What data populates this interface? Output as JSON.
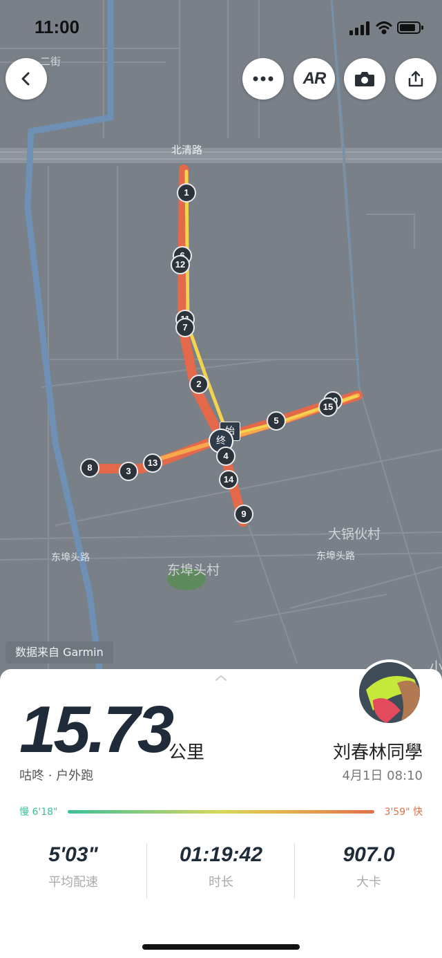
{
  "status": {
    "time": "11:00"
  },
  "map": {
    "roads": {
      "top_left": "二街",
      "north": "北清路",
      "south_left": "东埠头路",
      "south_right": "东埠头路"
    },
    "places": {
      "village_se": "大锅伙村",
      "village_s": "东埠头村",
      "edge": "小"
    },
    "start_label": "始",
    "end_label": "终",
    "markers": [
      "1",
      "2",
      "3",
      "4",
      "5",
      "6",
      "7",
      "8",
      "9",
      "10",
      "11",
      "12",
      "13",
      "14",
      "15"
    ],
    "data_source": "数据来自 Garmin"
  },
  "toolbar": {
    "back_icon": "chevron-left-icon",
    "more_icon": "more-dots-icon",
    "ar_label": "AR",
    "camera_icon": "camera-icon",
    "share_icon": "share-icon"
  },
  "summary": {
    "distance": "15.73",
    "unit": "公里",
    "app_type": "咕咚 · 户外跑",
    "user_name": "刘春林同學",
    "date_time": "4月1日 08:10",
    "pace_slow": "慢 6'18\"",
    "pace_fast": "3'59\" 快",
    "stats": [
      {
        "value": "5'03\"",
        "label": "平均配速"
      },
      {
        "value": "01:19:42",
        "label": "时长"
      },
      {
        "value": "907.0",
        "label": "大卡"
      }
    ]
  },
  "colors": {
    "map_bg": "#7a8088",
    "route_red": "#e4684a",
    "route_yellow": "#f3d24e",
    "river": "#6d90b4",
    "pace_slow": "#3bbf99",
    "pace_fast": "#e0704a"
  }
}
